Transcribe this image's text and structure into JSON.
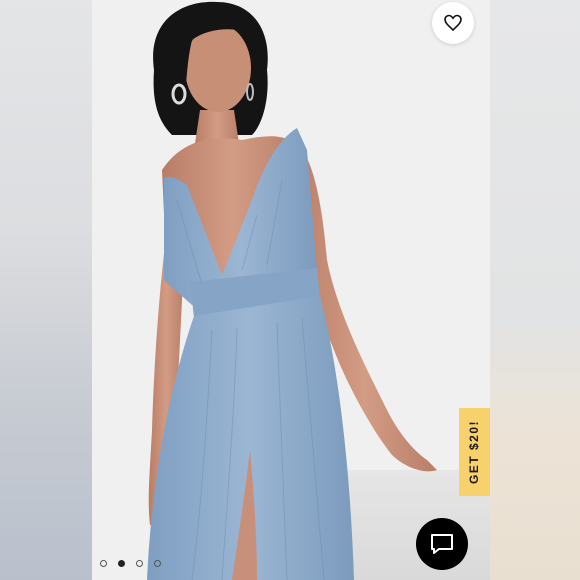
{
  "promo": {
    "label": "GET $20!",
    "color": "#f7d16b"
  },
  "favorite": {
    "icon": "heart-icon"
  },
  "chat": {
    "icon": "chat-bubble-icon"
  },
  "carousel": {
    "total": 4,
    "active_index": 1
  },
  "colors": {
    "dress": "#8eaccd",
    "skin": "#c9927a",
    "hair": "#141414"
  }
}
